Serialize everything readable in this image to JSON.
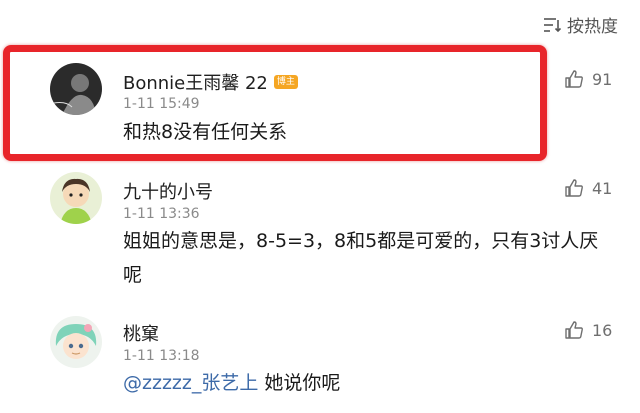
{
  "sort": {
    "label": "按热度",
    "icon": "sort-icon"
  },
  "comments": [
    {
      "author": "Bonnie王雨馨 22",
      "badge": "博主",
      "time": "1-11 15:49",
      "text": "和热8没有任何关系",
      "likes": "91",
      "highlighted": true
    },
    {
      "author": "九十的小号",
      "time": "1-11 13:36",
      "text": "姐姐的意思是，8-5=3，8和5都是可爱的，只有3讨人厌呢",
      "likes": "41"
    },
    {
      "author": "桃窠",
      "time": "1-11 13:18",
      "mention": "@zzzzz_张艺上",
      "text": " 她说你呢",
      "likes": "16"
    }
  ],
  "colors": {
    "highlight": "#e8252a",
    "mention": "#3d6aa8",
    "badge": "#f5a623"
  }
}
